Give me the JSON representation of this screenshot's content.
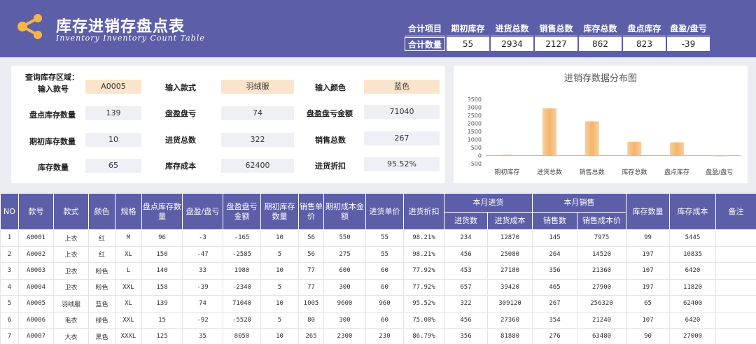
{
  "header": {
    "title": "库存进销存盘点表",
    "subtitle": "Inventory Inventory Count Table",
    "summary": {
      "headers": [
        "合计项目",
        "期初库存",
        "进货总数",
        "销售总数",
        "库存总数",
        "盘点库存",
        "盘盈/盘亏"
      ],
      "row_label": "合计数量",
      "values": [
        "55",
        "2934",
        "2127",
        "862",
        "823",
        "-39"
      ]
    }
  },
  "query": {
    "title": "查询库存区域：",
    "style_no_label": "输入款号",
    "style_no_value": "A0005",
    "style_label": "输入款式",
    "style_value": "羽绒服",
    "color_label": "输入颜色",
    "color_value": "蓝色",
    "count_qty_label": "盘点库存数量",
    "count_qty_value": "139",
    "pl_label": "盘盈盘亏",
    "pl_value": "74",
    "pl_amount_label": "盘盈盘亏金额",
    "pl_amount_value": "71040",
    "opening_label": "期初库存数量",
    "opening_value": "10",
    "purchase_label": "进货总数",
    "purchase_value": "322",
    "sales_label": "销售总数",
    "sales_value": "267",
    "stock_label": "库存数量",
    "stock_value": "65",
    "cost_label": "库存成本",
    "cost_value": "62400",
    "discount_label": "进货折扣",
    "discount_value": "95.52%"
  },
  "chart_data": {
    "type": "bar",
    "title": "进销存数据分布图",
    "categories": [
      "期初库存",
      "进货总数",
      "销售总数",
      "库存总数",
      "盘点库存",
      "盘盈/盘亏"
    ],
    "values": [
      55,
      2934,
      2127,
      862,
      823,
      -39
    ],
    "ylim": [
      -500,
      3500
    ],
    "yticks": [
      -500,
      0,
      500,
      1000,
      1500,
      2000,
      2500,
      3000,
      3500
    ],
    "bar_color": "#f5b56a",
    "grid": false
  },
  "table": {
    "headers": {
      "no": "NO",
      "style_no": "款号",
      "style": "款式",
      "color": "颜色",
      "size": "规格",
      "count_stock": "盘点库存数量",
      "pl": "盘盈/盘亏",
      "pl_amount": "盘盈盘亏金额",
      "opening": "期初库存数量",
      "unit_price": "销售单价",
      "opening_cost": "期初成本金额",
      "purchase_price": "进货单价",
      "discount": "进货折扣",
      "month_purchase": "本月进货",
      "purchase_qty": "进货数",
      "purchase_cost": "进货成本",
      "month_sales": "本月销售",
      "sales_qty": "销售数",
      "sales_cost": "销售成本价",
      "stock_qty": "库存数量",
      "stock_cost": "库存成本",
      "remark": "备注"
    },
    "rows": [
      [
        "1",
        "A0001",
        "上衣",
        "红",
        "M",
        "96",
        "-3",
        "-165",
        "10",
        "56",
        "550",
        "55",
        "98.21%",
        "234",
        "12870",
        "145",
        "7975",
        "99",
        "5445",
        ""
      ],
      [
        "2",
        "A0002",
        "上衣",
        "红",
        "XL",
        "150",
        "-47",
        "-2585",
        "5",
        "56",
        "275",
        "55",
        "98.21%",
        "456",
        "25080",
        "264",
        "14520",
        "197",
        "10835",
        ""
      ],
      [
        "3",
        "A0003",
        "卫衣",
        "粉色",
        "L",
        "140",
        "33",
        "1980",
        "10",
        "77",
        "600",
        "60",
        "77.92%",
        "453",
        "27180",
        "356",
        "21360",
        "107",
        "6420",
        ""
      ],
      [
        "4",
        "A0004",
        "卫衣",
        "粉色",
        "XXL",
        "158",
        "-39",
        "-2340",
        "5",
        "77",
        "300",
        "60",
        "77.92%",
        "657",
        "39420",
        "465",
        "27900",
        "197",
        "11820",
        ""
      ],
      [
        "5",
        "A0005",
        "羽绒服",
        "蓝色",
        "XL",
        "139",
        "74",
        "71040",
        "10",
        "1005",
        "9600",
        "960",
        "95.52%",
        "322",
        "309120",
        "267",
        "256320",
        "65",
        "62400",
        ""
      ],
      [
        "6",
        "A0006",
        "毛衣",
        "绿色",
        "XXL",
        "15",
        "-92",
        "-5520",
        "5",
        "80",
        "300",
        "60",
        "75.00%",
        "456",
        "27360",
        "354",
        "21240",
        "107",
        "6420",
        ""
      ],
      [
        "7",
        "A0007",
        "大衣",
        "黑色",
        "XXXL",
        "125",
        "35",
        "8050",
        "10",
        "265",
        "2300",
        "230",
        "86.79%",
        "356",
        "81880",
        "276",
        "63480",
        "90",
        "27000",
        ""
      ]
    ]
  },
  "colors": {
    "header_bg": "#5c5fa8",
    "accent_orange": "#f5b56a",
    "input_bg": "#fbe4cc"
  }
}
